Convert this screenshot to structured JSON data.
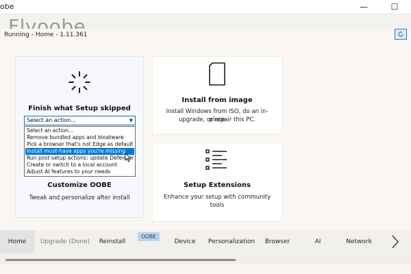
{
  "window": {
    "title": "obe",
    "minimize_glyph": "—",
    "maximize_glyph": "☐",
    "background_heading": "Flyoobe"
  },
  "status": {
    "text": "Running - Home - 1.11.361",
    "refresh_icon": "refresh-icon"
  },
  "cards": {
    "setup": {
      "title": "Finish what Setup skipped",
      "icon": "loading-circle-icon",
      "select_value": "Select an action...",
      "options": [
        "Select an action...",
        "Remove bundled apps and bloatware",
        "Pick a browser that's not Edge as default",
        "Install must-have apps you're missing",
        "Run post-setup actions: update Defender",
        "Create or switch to a local account",
        "Adjust AI features to your needs"
      ],
      "selected_index": 3
    },
    "image": {
      "title": "Install from image",
      "icon": "document-icon",
      "desc_1": "Install Windows from ISO, do an in-place",
      "desc_2": "upgrade, or repair this PC."
    },
    "oobe": {
      "title": "Customize OOBE",
      "desc": "Tweak and personalize after install"
    },
    "extensions": {
      "title": "Setup Extensions",
      "icon": "list-icon",
      "desc": "Enhance your setup with community tools"
    }
  },
  "nav": {
    "items": [
      "Home",
      "Upgrade (Done)",
      "Reinstall",
      "Device",
      "Personalization",
      "Browser",
      "AI",
      "Network"
    ],
    "badge": "OOBE",
    "next_icon": "chevron-right-icon"
  },
  "colors": {
    "accent": "#0078d7",
    "overlay": "#faf7f3"
  }
}
